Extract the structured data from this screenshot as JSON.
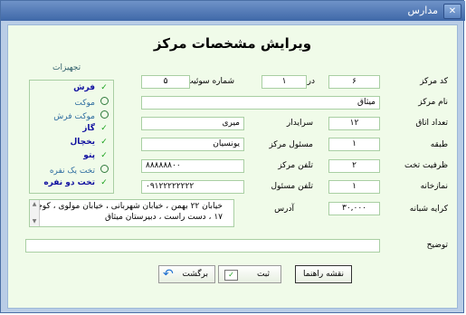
{
  "window": {
    "title": "مدارس",
    "close_glyph": "✕"
  },
  "form": {
    "heading": "ویرایش مشخصات مرکز",
    "center_code": {
      "label": "کد مرکز",
      "value": "۶"
    },
    "grade": {
      "label": "درجه",
      "value": "۱"
    },
    "suite_number": {
      "label": "شماره سوئیت",
      "value": "۵"
    },
    "center_name": {
      "label": "نام مرکز",
      "value": "میثاق"
    },
    "room_count": {
      "label": "تعداد اتاق",
      "value": "۱۲"
    },
    "caretaker": {
      "label": "سرایدار",
      "value": "میری"
    },
    "floor": {
      "label": "طبقه",
      "value": "۱"
    },
    "center_manager": {
      "label": "مسئول مرکز",
      "value": "یونسیان"
    },
    "bed_capacity": {
      "label": "ظرفیت تخت",
      "value": "۲"
    },
    "center_phone": {
      "label": "تلفن مرکز",
      "value": "۸۸۸۸۸۸۰۰"
    },
    "prayer_room": {
      "label": "نمازخانه",
      "value": "۱"
    },
    "manager_phone": {
      "label": "تلفن مسئول",
      "value": "۰۹۱۲۲۲۲۲۲۲۲"
    },
    "nightly_rent": {
      "label": "کرایه شبانه",
      "value": "۳۰,۰۰۰"
    },
    "address": {
      "label": "آدرس",
      "value": "خیابان ۲۲ بهمن ، خیابان شهربانی ، خیابان مولوی ، کوچه ۱۷ ، دست راست ، دبیرستان میثاق"
    },
    "description": {
      "label": "توضیح",
      "value": ""
    }
  },
  "equipment": {
    "title": "تجهیزات",
    "items": [
      {
        "label": "فرش",
        "checked": true
      },
      {
        "label": "موکت",
        "checked": false
      },
      {
        "label": "موکت فرش",
        "checked": false
      },
      {
        "label": "گاز",
        "checked": true
      },
      {
        "label": "یخچال",
        "checked": true
      },
      {
        "label": "پتو",
        "checked": true
      },
      {
        "label": "تخت یک نفره",
        "checked": false
      },
      {
        "label": "تخت دو نفره",
        "checked": true
      }
    ]
  },
  "buttons": {
    "guide_map": "نقشه راهنما",
    "submit": "ثبت",
    "back": "برگشت"
  },
  "colors": {
    "panel_bg": "#f0fbe9",
    "window_bg": "#b9cde6",
    "titlebar": "#3f68a8",
    "field_border": "#a9cfa3",
    "check": "#17a11a"
  }
}
